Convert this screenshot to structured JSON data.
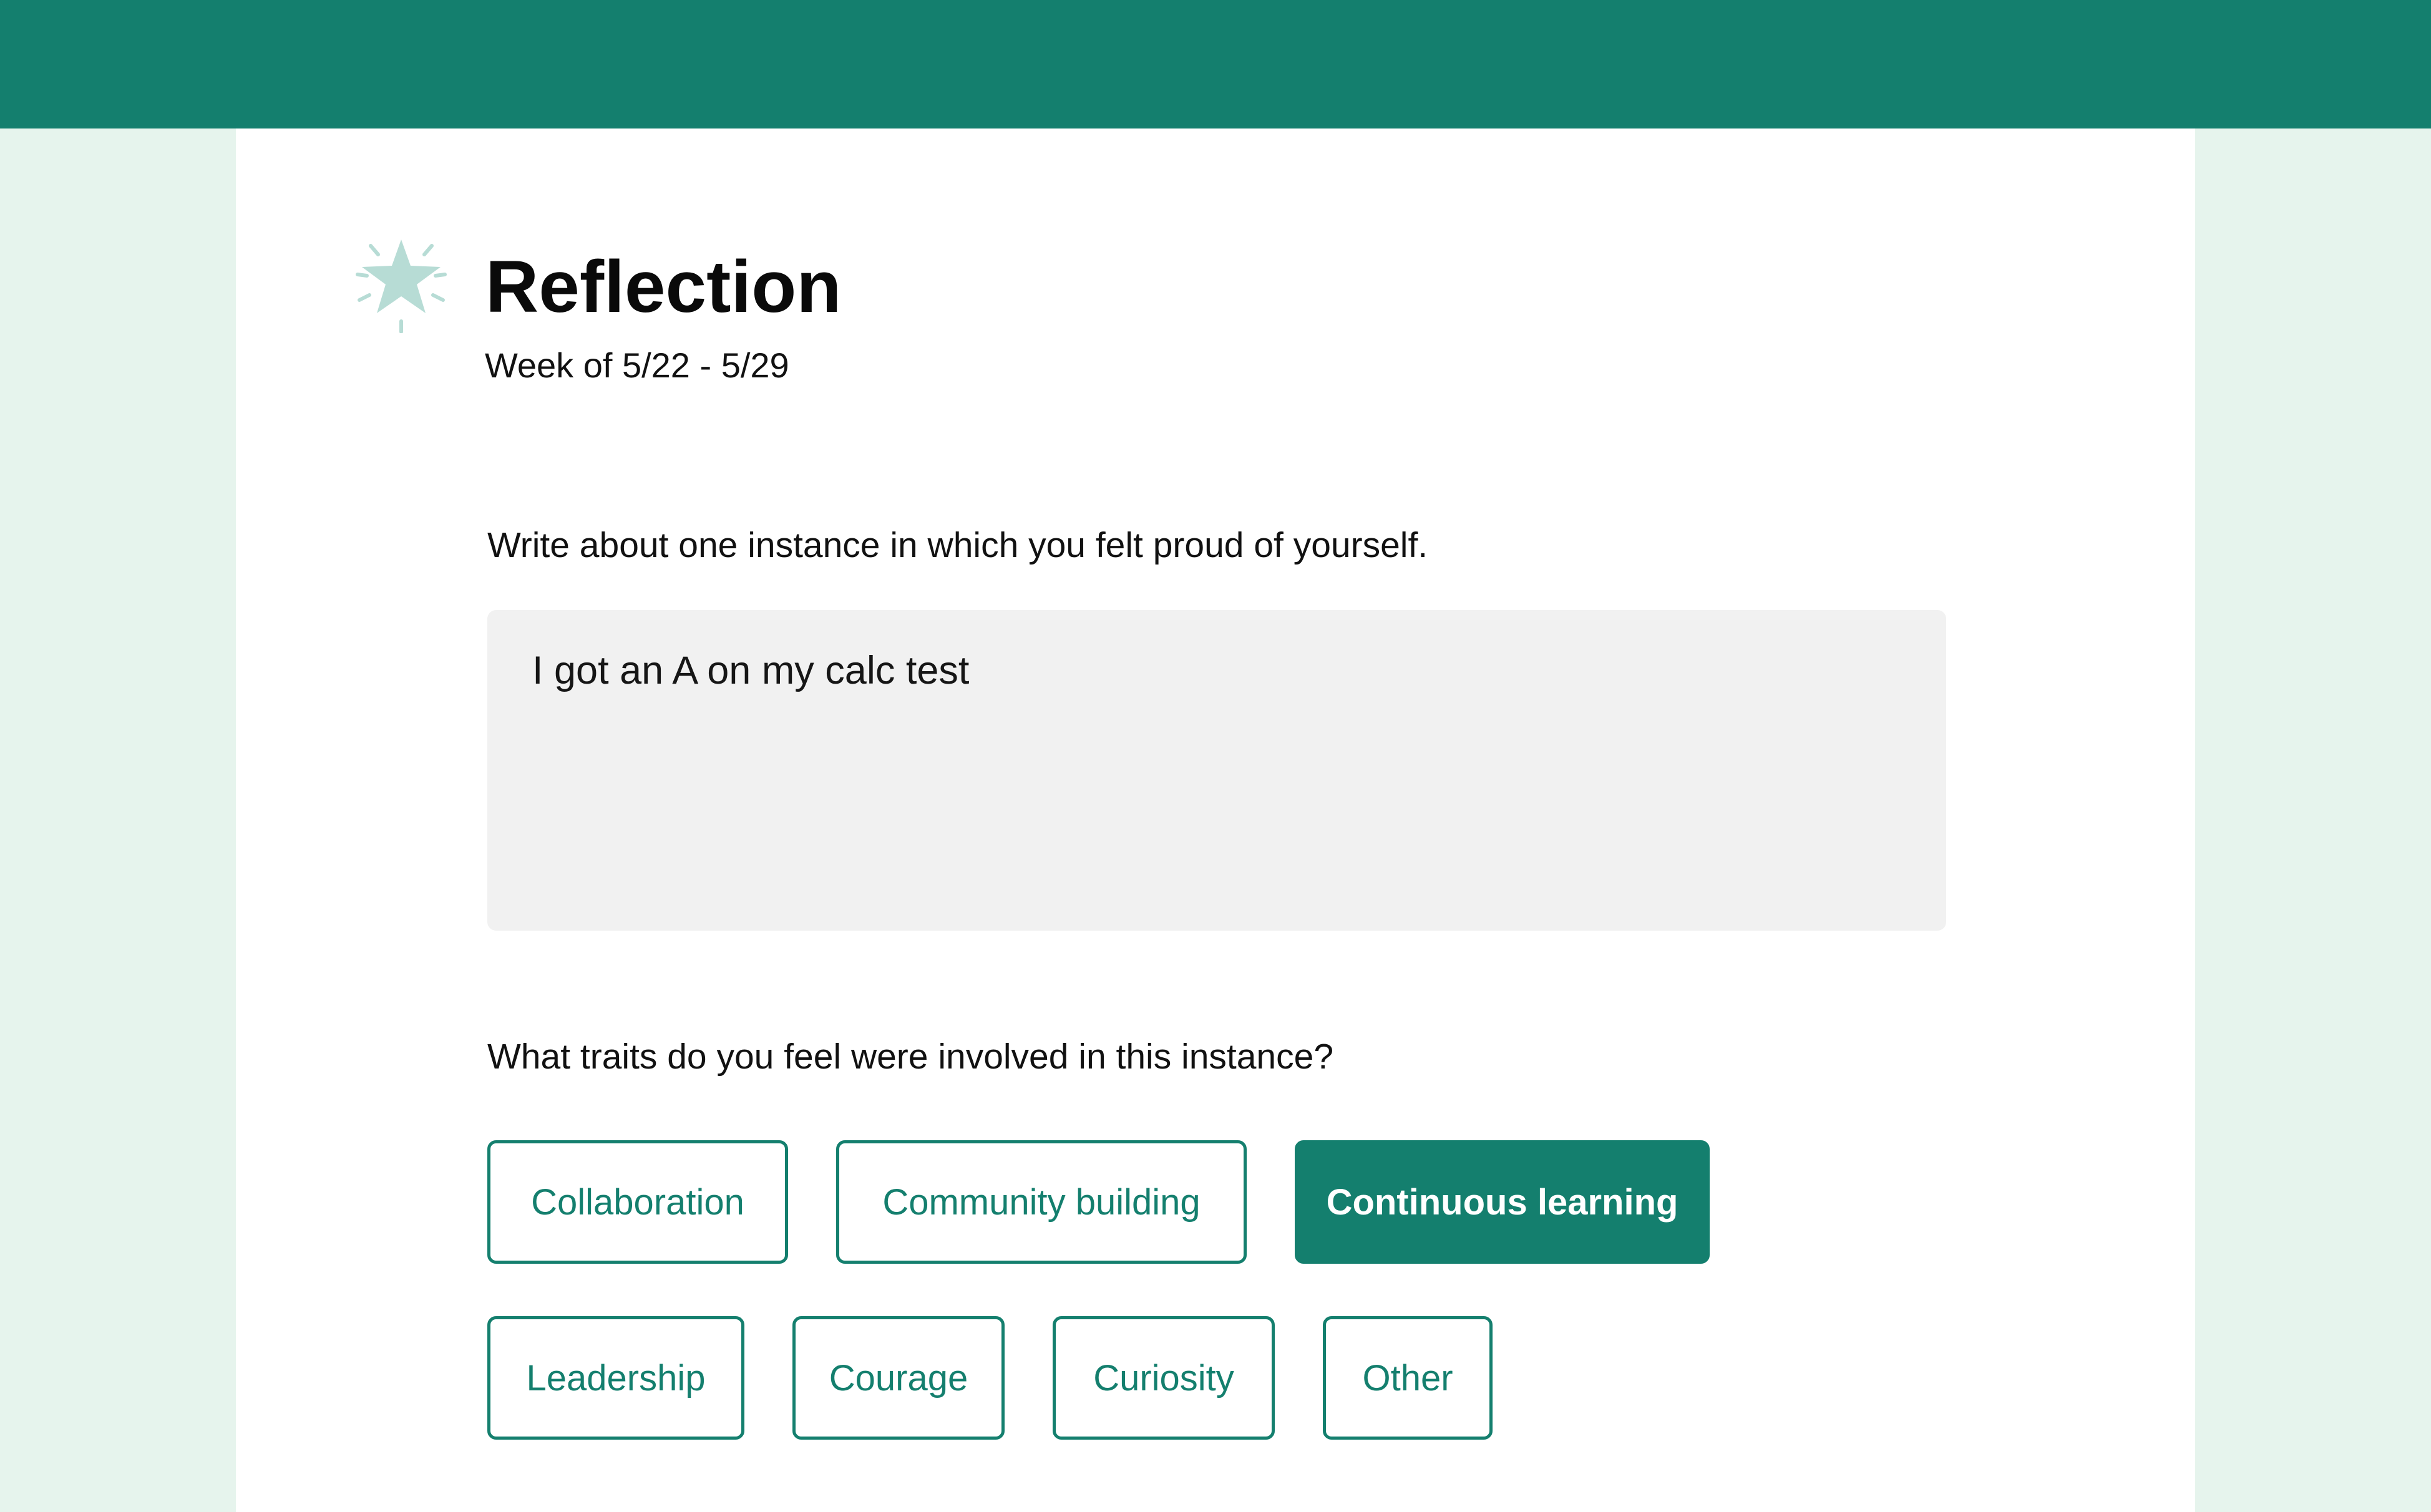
{
  "header": {
    "title": "Reflection",
    "subtitle": "Week of 5/22 - 5/29",
    "icon": "sparkle-star-icon"
  },
  "prompt": {
    "question": "Write about one instance in which you felt proud of yourself.",
    "answer": "I got an A on my calc test"
  },
  "traits": {
    "question": "What traits do you feel were involved in this instance?",
    "options": [
      {
        "label": "Collaboration",
        "selected": false
      },
      {
        "label": "Community building",
        "selected": false
      },
      {
        "label": "Continuous learning",
        "selected": true
      },
      {
        "label": "Leadership",
        "selected": false
      },
      {
        "label": "Courage",
        "selected": false
      },
      {
        "label": "Curiosity",
        "selected": false
      },
      {
        "label": "Other",
        "selected": false
      }
    ]
  },
  "colors": {
    "accent": "#147f6e",
    "background": "#e6f4ed",
    "card": "#ffffff",
    "input_fill": "#f1f1f1",
    "icon": "#b7dcd5"
  }
}
